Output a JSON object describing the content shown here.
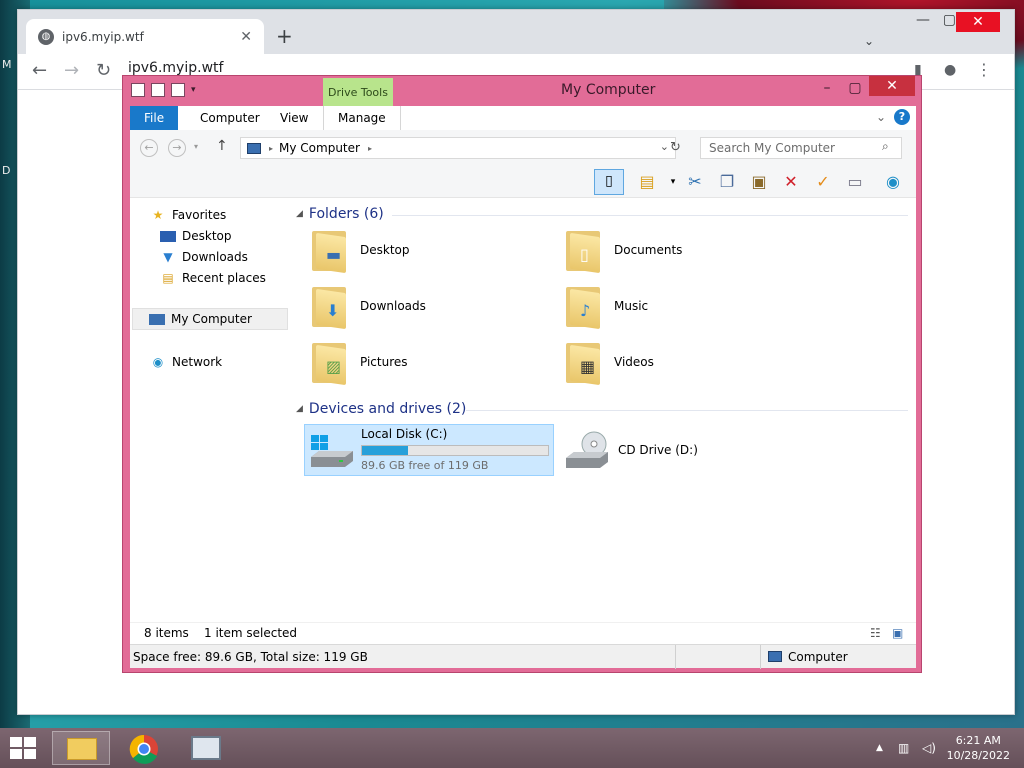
{
  "desktop": {
    "left_text_1": "M",
    "left_text_2": "D"
  },
  "browser": {
    "tab_title": "ipv6.myip.wtf",
    "new_tab": "+",
    "url": "ipv6.myip.wtf",
    "min": "—",
    "max": "▢",
    "close": "✕",
    "chevron": "⌄"
  },
  "explorer": {
    "title": "My Computer",
    "contextual_tab": "Drive Tools",
    "ribbon_tabs": {
      "file": "File",
      "computer": "Computer",
      "view": "View",
      "manage": "Manage"
    },
    "help": "?",
    "address": {
      "path": "My Computer"
    },
    "search": {
      "placeholder": "Search My Computer"
    },
    "nav_pane": {
      "favorites": "Favorites",
      "desktop": "Desktop",
      "downloads": "Downloads",
      "recent": "Recent places",
      "my_computer": "My Computer",
      "network": "Network"
    },
    "folders_header": "Folders (6)",
    "folders": [
      "Desktop",
      "Documents",
      "Downloads",
      "Music",
      "Pictures",
      "Videos"
    ],
    "devices_header": "Devices and drives (2)",
    "drive_c": {
      "name": "Local Disk (C:)",
      "free": "89.6 GB free of 119 GB",
      "used_fraction": 0.247
    },
    "drive_d": {
      "name": "CD Drive (D:)"
    },
    "status": {
      "items": "8 items",
      "selected": "1 item selected"
    },
    "bottom": {
      "space": "Space free: 89.6 GB, Total size: 119 GB",
      "location": "Computer"
    },
    "colors": {
      "accent": "#e26c97",
      "selection": "#cce8ff",
      "bar": "#26a0da"
    }
  },
  "taskbar": {
    "time": "6:21 AM",
    "date": "10/28/2022"
  }
}
